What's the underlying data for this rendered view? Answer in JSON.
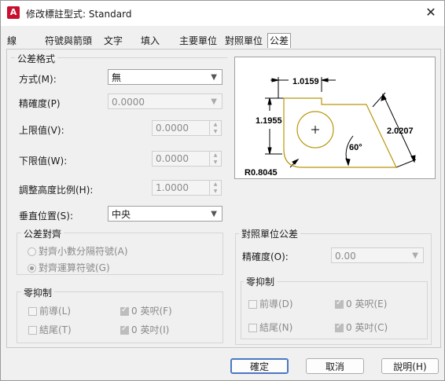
{
  "window": {
    "title": "修改標註型式: Standard",
    "app_icon_letter": "A"
  },
  "tabs": [
    "線",
    "符號與箭頭",
    "文字",
    "填入",
    "主要單位",
    "對照單位",
    "公差"
  ],
  "tolerance_format": {
    "group_label": "公差格式",
    "method_label": "方式(M):",
    "method_value": "無",
    "precision_label": "精確度(P)",
    "precision_value": "0.0000",
    "upper_label": "上限值(V):",
    "upper_value": "0.0000",
    "lower_label": "下限值(W):",
    "lower_value": "0.0000",
    "scale_label": "調整高度比例(H):",
    "scale_value": "1.0000",
    "vertical_label": "垂直位置(S):",
    "vertical_value": "中央"
  },
  "tolerance_alignment": {
    "group_label": "公差對齊",
    "option1": "對齊小數分隔符號(A)",
    "option2": "對齊運算符號(G)"
  },
  "zero_suppression_left": {
    "group_label": "零抑制",
    "leading": "前導(L)",
    "feet": "0 英呎(F)",
    "trailing": "結尾(T)",
    "inches": "0 英吋(I)"
  },
  "alt_unit_tolerance": {
    "group_label": "對照單位公差",
    "precision_label": "精確度(O):",
    "precision_value": "0.00",
    "zero_group_label": "零抑制",
    "leading": "前導(D)",
    "feet": "0 英呎(E)",
    "trailing": "結尾(N)",
    "inches": "0 英吋(C)"
  },
  "preview": {
    "dim_top": "1.0159",
    "dim_left": "1.1955",
    "dim_right": "2.0207",
    "angle": "60°",
    "radius": "R0.8045"
  },
  "buttons": {
    "ok": "確定",
    "cancel": "取消",
    "help": "說明(H)"
  },
  "colors": {
    "part_outline": "#b8960c",
    "accent": "#4a78c2"
  }
}
